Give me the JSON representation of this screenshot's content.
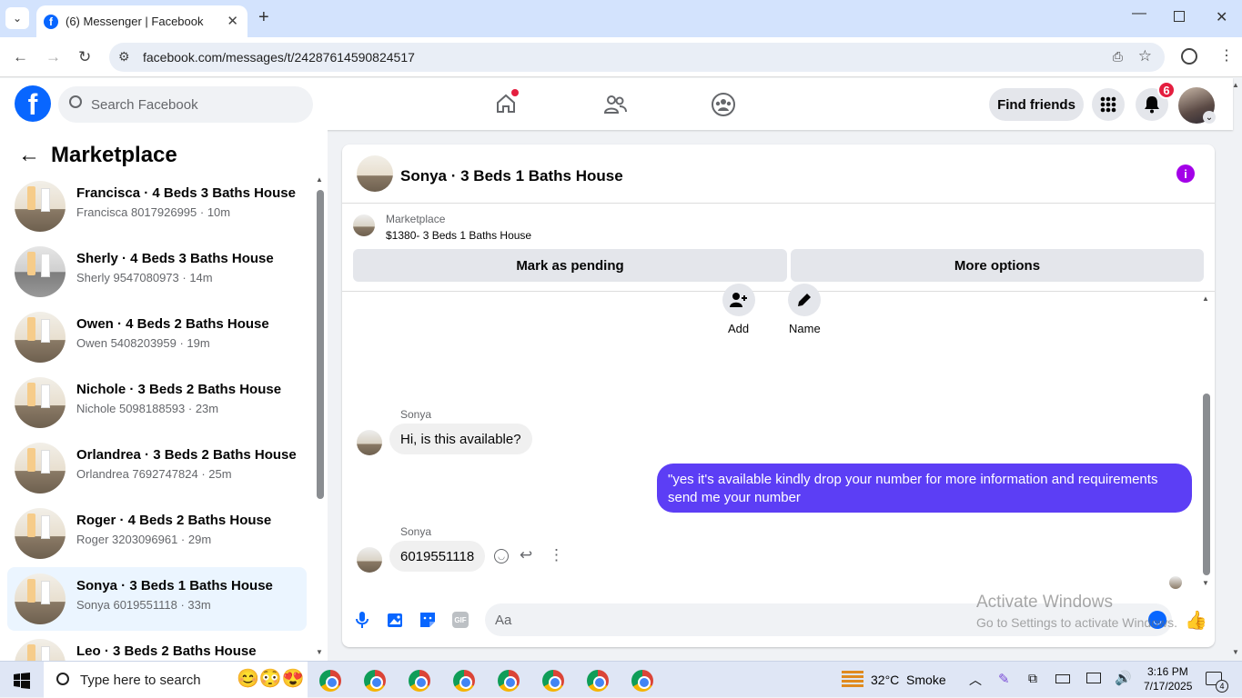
{
  "browser": {
    "tab_title": "(6) Messenger | Facebook",
    "url": "facebook.com/messages/t/24287614590824517"
  },
  "header": {
    "search_placeholder": "Search Facebook",
    "find_friends": "Find friends",
    "notification_count": "6"
  },
  "sidebar": {
    "title": "Marketplace",
    "conversations": [
      {
        "title": "Francisca · 4 Beds 3 Baths House",
        "subtitle": "Francisca 8017926995 · 10m"
      },
      {
        "title": "Sherly · 4 Beds 3 Baths House",
        "subtitle": "Sherly 9547080973 · 14m"
      },
      {
        "title": "Owen · 4 Beds 2 Baths House",
        "subtitle": "Owen 5408203959 · 19m"
      },
      {
        "title": "Nichole · 3 Beds 2 Baths House",
        "subtitle": "Nichole 5098188593 · 23m"
      },
      {
        "title": "Orlandrea · 3 Beds 2 Baths House",
        "subtitle": "Orlandrea 7692747824 · 25m"
      },
      {
        "title": "Roger · 4 Beds 2 Baths House",
        "subtitle": "Roger 3203096961 · 29m"
      },
      {
        "title": "Sonya · 3 Beds 1 Baths House",
        "subtitle": "Sonya 6019551118 · 33m"
      },
      {
        "title": "Leo · 3 Beds 2 Baths House",
        "subtitle": ""
      }
    ]
  },
  "chat": {
    "title": "Sonya · 3 Beds 1 Baths House",
    "listing_label": "Marketplace",
    "listing_price": "$1380- 3 Beds 1 Baths House",
    "mark_pending": "Mark as pending",
    "more_options": "More options",
    "add_label": "Add",
    "name_label": "Name",
    "messages": [
      {
        "sender": "Sonya",
        "text": "Hi, is this available?"
      },
      {
        "sender": "",
        "text": "\"yes it's available kindly drop your number for more information and requirements send me your number"
      },
      {
        "sender": "Sonya",
        "text": "6019551118"
      }
    ],
    "composer_placeholder": "Aa",
    "gif_label": "GIF"
  },
  "watermark": {
    "line1": "Activate Windows",
    "line2": "Go to Settings to activate Windows."
  },
  "taskbar": {
    "search_placeholder": "Type here to search",
    "weather": "32°C  Smoke",
    "time": "3:16 PM",
    "date": "7/17/2025",
    "notif_count": "4"
  }
}
